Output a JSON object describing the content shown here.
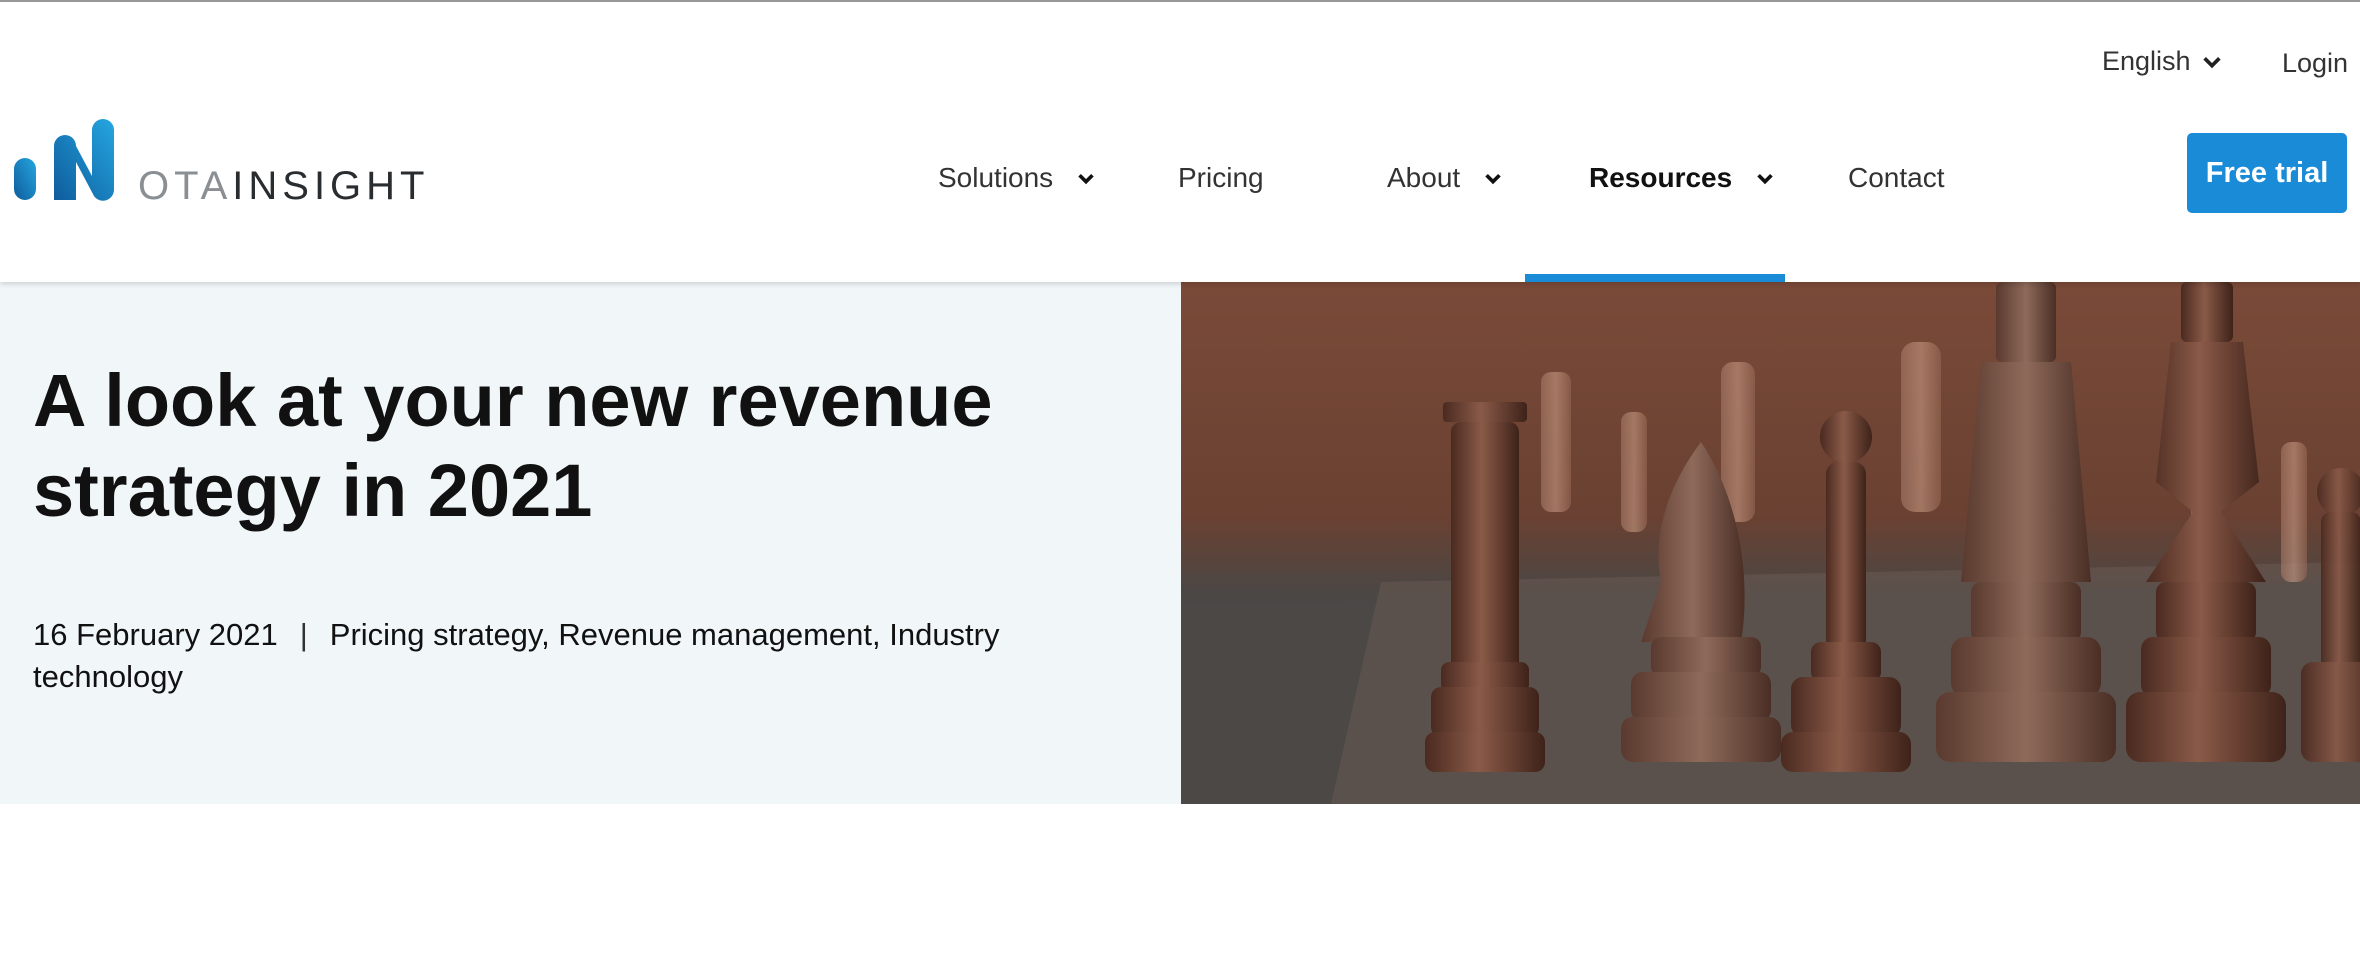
{
  "header": {
    "logo": {
      "ota": "OTA",
      "insight": "INSIGHT"
    },
    "language": {
      "label": "English"
    },
    "login": {
      "label": "Login"
    },
    "nav": [
      {
        "label": "Solutions",
        "has_dropdown": true,
        "active": false
      },
      {
        "label": "Pricing",
        "has_dropdown": false,
        "active": false
      },
      {
        "label": "About",
        "has_dropdown": true,
        "active": false
      },
      {
        "label": "Resources",
        "has_dropdown": true,
        "active": true
      },
      {
        "label": "Contact",
        "has_dropdown": false,
        "active": false
      }
    ],
    "cta": {
      "label": "Free trial"
    }
  },
  "article": {
    "title": "A look at your new revenue strategy in 2021",
    "date": "16 February 2021",
    "separator": "|",
    "categories": "Pricing strategy, Revenue management, Industry technology",
    "hero_image": "chess-pieces-photo"
  },
  "colors": {
    "accent": "#1a8bd6",
    "hero_bg": "#f1f6f8",
    "logo_gradient_start": "#0e5c9c",
    "logo_gradient_end": "#25a6e0"
  }
}
